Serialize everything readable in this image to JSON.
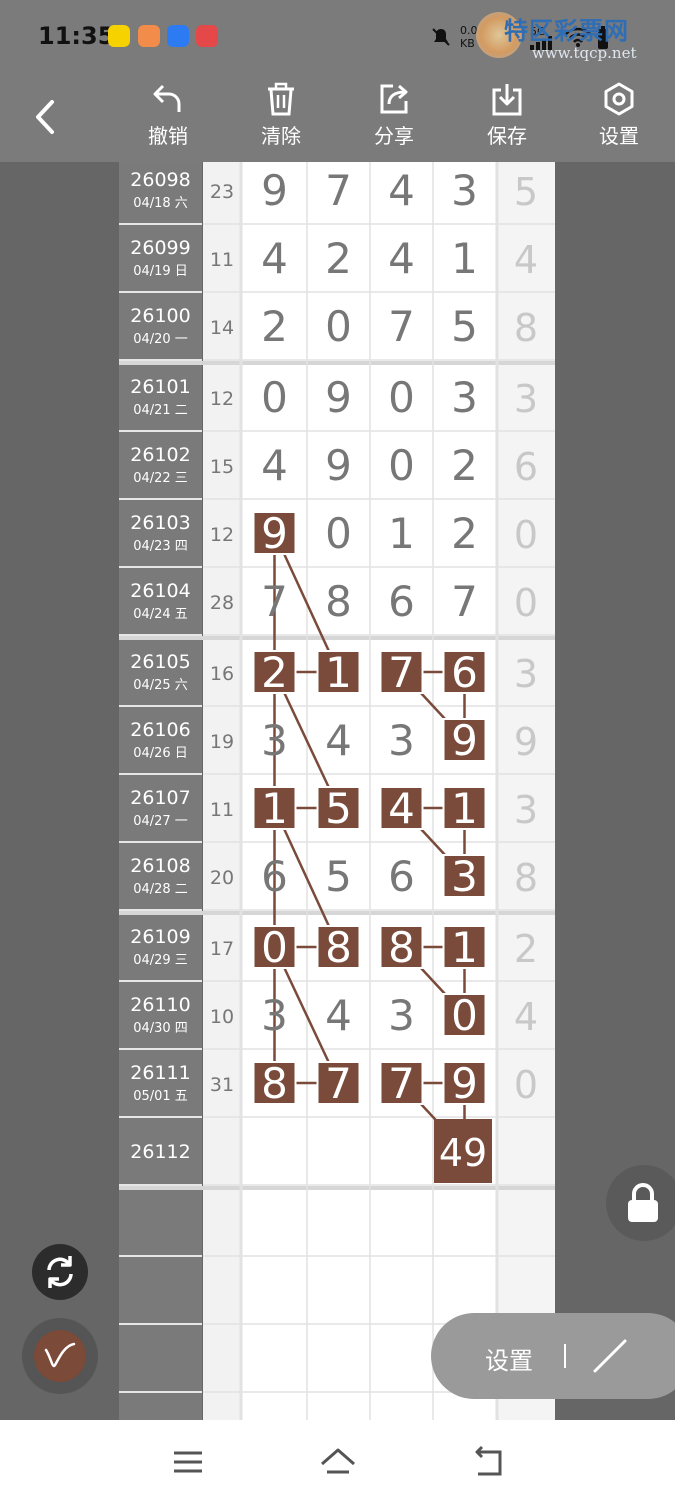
{
  "status": {
    "time": "11:35",
    "net_speed": "0.0",
    "net_unit": "KB",
    "net_tag": "5G"
  },
  "watermark": {
    "logo": "特区彩票网",
    "url": "www.tqcp.net"
  },
  "toolbar": {
    "undo": "撤销",
    "clear": "清除",
    "share": "分享",
    "save": "保存",
    "settings": "设置"
  },
  "rows": [
    {
      "issue": "26098",
      "date": "04/18 六",
      "sum": "23",
      "digits": [
        "9",
        "7",
        "4",
        "3"
      ],
      "tail": "5"
    },
    {
      "issue": "26099",
      "date": "04/19 日",
      "sum": "11",
      "digits": [
        "4",
        "2",
        "4",
        "1"
      ],
      "tail": "4"
    },
    {
      "issue": "26100",
      "date": "04/20 一",
      "sum": "14",
      "digits": [
        "2",
        "0",
        "7",
        "5"
      ],
      "tail": "8"
    },
    {
      "issue": "26101",
      "date": "04/21 二",
      "sum": "12",
      "digits": [
        "0",
        "9",
        "0",
        "3"
      ],
      "tail": "3"
    },
    {
      "issue": "26102",
      "date": "04/22 三",
      "sum": "15",
      "digits": [
        "4",
        "9",
        "0",
        "2"
      ],
      "tail": "6"
    },
    {
      "issue": "26103",
      "date": "04/23 四",
      "sum": "12",
      "digits": [
        "9",
        "0",
        "1",
        "2"
      ],
      "tail": "0"
    },
    {
      "issue": "26104",
      "date": "04/24 五",
      "sum": "28",
      "digits": [
        "7",
        "8",
        "6",
        "7"
      ],
      "tail": "0"
    },
    {
      "issue": "26105",
      "date": "04/25 六",
      "sum": "16",
      "digits": [
        "2",
        "1",
        "7",
        "6"
      ],
      "tail": "3"
    },
    {
      "issue": "26106",
      "date": "04/26 日",
      "sum": "19",
      "digits": [
        "3",
        "4",
        "3",
        "9"
      ],
      "tail": "9"
    },
    {
      "issue": "26107",
      "date": "04/27 一",
      "sum": "11",
      "digits": [
        "1",
        "5",
        "4",
        "1"
      ],
      "tail": "3"
    },
    {
      "issue": "26108",
      "date": "04/28 二",
      "sum": "20",
      "digits": [
        "6",
        "5",
        "6",
        "3"
      ],
      "tail": "8"
    },
    {
      "issue": "26109",
      "date": "04/29 三",
      "sum": "17",
      "digits": [
        "0",
        "8",
        "8",
        "1"
      ],
      "tail": "2"
    },
    {
      "issue": "26110",
      "date": "04/30 四",
      "sum": "10",
      "digits": [
        "3",
        "4",
        "3",
        "0"
      ],
      "tail": "4"
    },
    {
      "issue": "26111",
      "date": "05/01 五",
      "sum": "31",
      "digits": [
        "8",
        "7",
        "7",
        "9"
      ],
      "tail": "0"
    },
    {
      "issue": "26112",
      "date": "",
      "sum": "",
      "digits": [
        "",
        "",
        "",
        ""
      ],
      "tail": ""
    }
  ],
  "highlights": [
    {
      "row": 5,
      "col": 0
    },
    {
      "row": 7,
      "col": 0
    },
    {
      "row": 7,
      "col": 1
    },
    {
      "row": 7,
      "col": 2
    },
    {
      "row": 7,
      "col": 3
    },
    {
      "row": 8,
      "col": 3
    },
    {
      "row": 9,
      "col": 0
    },
    {
      "row": 9,
      "col": 1
    },
    {
      "row": 9,
      "col": 2
    },
    {
      "row": 9,
      "col": 3
    },
    {
      "row": 10,
      "col": 3
    },
    {
      "row": 11,
      "col": 0
    },
    {
      "row": 11,
      "col": 1
    },
    {
      "row": 11,
      "col": 2
    },
    {
      "row": 11,
      "col": 3
    },
    {
      "row": 12,
      "col": 3
    },
    {
      "row": 13,
      "col": 0
    },
    {
      "row": 13,
      "col": 1
    },
    {
      "row": 13,
      "col": 2
    },
    {
      "row": 13,
      "col": 3
    }
  ],
  "prediction": {
    "text": "49",
    "row": 14,
    "col": 3
  },
  "links": [
    [
      [
        5,
        0
      ],
      [
        7,
        0
      ]
    ],
    [
      [
        5,
        0
      ],
      [
        7,
        1
      ]
    ],
    [
      [
        7,
        0
      ],
      [
        7,
        1
      ]
    ],
    [
      [
        7,
        2
      ],
      [
        7,
        3
      ]
    ],
    [
      [
        7,
        2
      ],
      [
        8,
        3
      ]
    ],
    [
      [
        7,
        3
      ],
      [
        8,
        3
      ]
    ],
    [
      [
        7,
        0
      ],
      [
        9,
        0
      ]
    ],
    [
      [
        7,
        0
      ],
      [
        9,
        1
      ]
    ],
    [
      [
        9,
        0
      ],
      [
        9,
        1
      ]
    ],
    [
      [
        9,
        2
      ],
      [
        9,
        3
      ]
    ],
    [
      [
        9,
        2
      ],
      [
        10,
        3
      ]
    ],
    [
      [
        9,
        3
      ],
      [
        10,
        3
      ]
    ],
    [
      [
        9,
        0
      ],
      [
        11,
        0
      ]
    ],
    [
      [
        9,
        0
      ],
      [
        11,
        1
      ]
    ],
    [
      [
        11,
        0
      ],
      [
        11,
        1
      ]
    ],
    [
      [
        11,
        2
      ],
      [
        11,
        3
      ]
    ],
    [
      [
        11,
        2
      ],
      [
        12,
        3
      ]
    ],
    [
      [
        11,
        3
      ],
      [
        12,
        3
      ]
    ],
    [
      [
        11,
        0
      ],
      [
        13,
        0
      ]
    ],
    [
      [
        11,
        0
      ],
      [
        13,
        1
      ]
    ],
    [
      [
        13,
        0
      ],
      [
        13,
        1
      ]
    ],
    [
      [
        13,
        2
      ],
      [
        13,
        3
      ]
    ],
    [
      [
        13,
        2
      ],
      [
        14,
        3
      ]
    ],
    [
      [
        13,
        3
      ],
      [
        14,
        3
      ]
    ]
  ],
  "empty_rows": 4,
  "settings_pill": {
    "label": "设置"
  },
  "colors": {
    "accent": "#7a4b3a",
    "toolbar": "#7b7b7b",
    "issue_col": "#7a7a7a"
  }
}
